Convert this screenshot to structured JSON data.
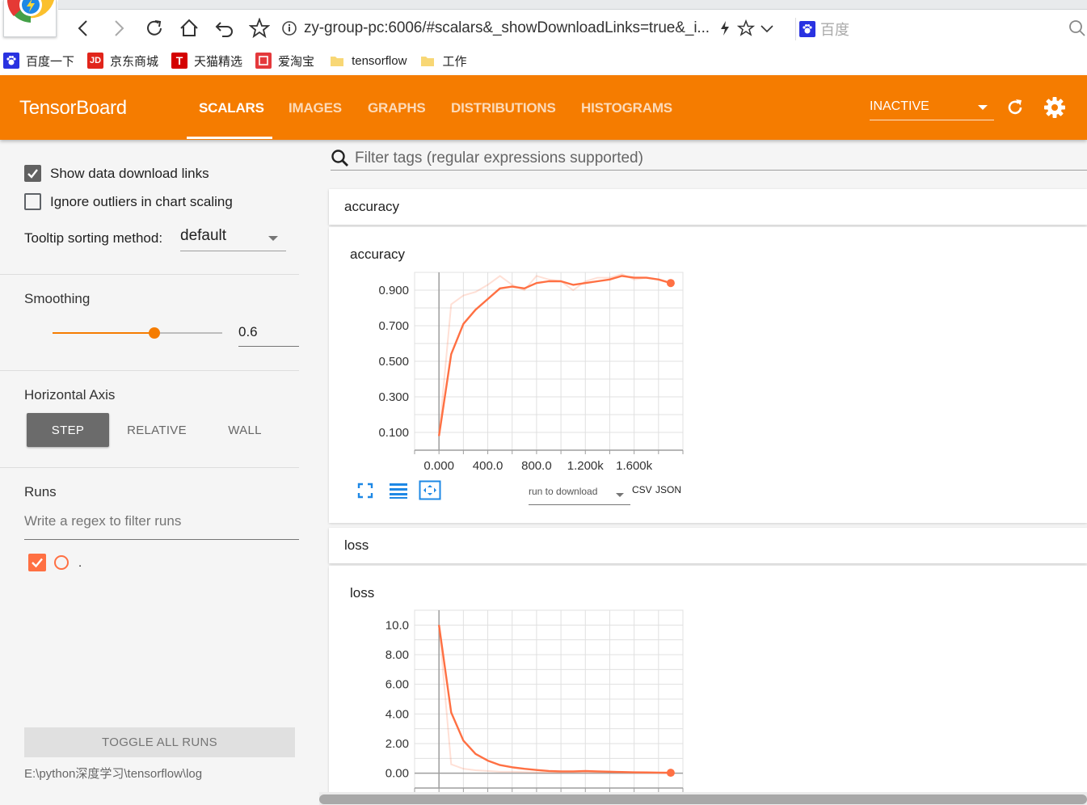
{
  "browser": {
    "url": "zy-group-pc:6006/#scalars&_showDownloadLinks=true&_i...",
    "search_engine": "百度",
    "bookmarks": [
      {
        "label": "百度一下",
        "icon": "paw-icon",
        "color": "#2932e1"
      },
      {
        "label": "京东商城",
        "icon": "jd-icon",
        "color": "#e1251b"
      },
      {
        "label": "天猫精选",
        "icon": "tmall-icon",
        "color": "#d40000"
      },
      {
        "label": "爱淘宝",
        "icon": "taobao-icon",
        "color": "#e4393c"
      },
      {
        "label": "tensorflow",
        "icon": "folder-icon",
        "color": "#f8d775"
      },
      {
        "label": "工作",
        "icon": "folder-icon",
        "color": "#f8d775"
      }
    ]
  },
  "header": {
    "title": "TensorBoard",
    "tabs": [
      "SCALARS",
      "IMAGES",
      "GRAPHS",
      "DISTRIBUTIONS",
      "HISTOGRAMS"
    ],
    "active_tab": "SCALARS",
    "run_status": "INACTIVE",
    "accent_color": "#f57c00"
  },
  "sidebar": {
    "show_download_links": {
      "label": "Show data download links",
      "checked": true
    },
    "ignore_outliers": {
      "label": "Ignore outliers in chart scaling",
      "checked": false
    },
    "tooltip_label": "Tooltip sorting method:",
    "tooltip_value": "default",
    "smoothing_label": "Smoothing",
    "smoothing_value": "0.6",
    "smoothing_fraction": 0.6,
    "horizontal_axis_label": "Horizontal Axis",
    "axis_options": [
      "STEP",
      "RELATIVE",
      "WALL"
    ],
    "axis_selected": "STEP",
    "runs_label": "Runs",
    "runs_filter_placeholder": "Write a regex to filter runs",
    "runs": [
      {
        "name": ".",
        "checked": true,
        "color": "#ff7043"
      }
    ],
    "toggle_all_label": "TOGGLE ALL RUNS",
    "logdir": "E:\\python深度学习\\tensorflow\\log"
  },
  "main": {
    "tag_filter_placeholder": "Filter tags (regular expressions supported)",
    "download": {
      "run_placeholder": "run to download",
      "csv": "CSV",
      "json": "JSON"
    },
    "categories": [
      {
        "name": "accuracy",
        "card_title": "accuracy"
      },
      {
        "name": "loss",
        "card_title": "loss"
      }
    ]
  },
  "chart_data": [
    {
      "type": "line",
      "title": "accuracy",
      "xlim": [
        -200,
        2000
      ],
      "ylim": [
        0.0,
        1.0
      ],
      "x_ticks": [
        0,
        400,
        800,
        1200,
        1600
      ],
      "x_tick_labels": [
        "0.000",
        "400.0",
        "800.0",
        "1.200k",
        "1.600k"
      ],
      "y_ticks": [
        0.1,
        0.3,
        0.5,
        0.7,
        0.9
      ],
      "y_tick_labels": [
        "0.100",
        "0.300",
        "0.500",
        "0.700",
        "0.900"
      ],
      "grid": true,
      "series": [
        {
          "color": "#ff7043",
          "x": [
            0,
            100,
            200,
            300,
            400,
            500,
            600,
            700,
            800,
            900,
            1000,
            1100,
            1200,
            1300,
            1400,
            1500,
            1600,
            1700,
            1800,
            1900
          ],
          "raw": [
            0.08,
            0.82,
            0.87,
            0.89,
            0.93,
            0.98,
            0.93,
            0.9,
            0.98,
            0.96,
            0.95,
            0.9,
            0.95,
            0.97,
            0.97,
            0.99,
            0.96,
            0.97,
            0.96,
            0.94
          ],
          "smoothed": [
            0.08,
            0.54,
            0.71,
            0.79,
            0.85,
            0.91,
            0.92,
            0.91,
            0.94,
            0.95,
            0.95,
            0.93,
            0.94,
            0.95,
            0.96,
            0.98,
            0.97,
            0.97,
            0.96,
            0.94
          ]
        }
      ]
    },
    {
      "type": "line",
      "title": "loss",
      "xlim": [
        -200,
        2000
      ],
      "ylim": [
        -1.0,
        11.0
      ],
      "x_ticks": [
        0,
        400,
        800,
        1200,
        1600
      ],
      "y_ticks": [
        0,
        2,
        4,
        6,
        8,
        10
      ],
      "y_tick_labels": [
        "0.00",
        "2.00",
        "4.00",
        "6.00",
        "8.00",
        "10.0"
      ],
      "grid": true,
      "series": [
        {
          "color": "#ff7043",
          "x": [
            0,
            100,
            200,
            300,
            400,
            500,
            600,
            700,
            800,
            900,
            1000,
            1100,
            1200,
            1300,
            1400,
            1500,
            1600,
            1700,
            1800,
            1900
          ],
          "raw": [
            10.0,
            0.6,
            0.3,
            0.2,
            0.15,
            0.1,
            0.1,
            0.08,
            0.06,
            0.05,
            0.05,
            0.07,
            0.05,
            0.05,
            0.04,
            0.04,
            0.03,
            0.03,
            0.03,
            0.02
          ],
          "smoothed": [
            10.0,
            4.1,
            2.2,
            1.3,
            0.85,
            0.55,
            0.4,
            0.3,
            0.22,
            0.15,
            0.12,
            0.12,
            0.15,
            0.12,
            0.1,
            0.08,
            0.06,
            0.05,
            0.04,
            0.03
          ]
        }
      ]
    }
  ]
}
